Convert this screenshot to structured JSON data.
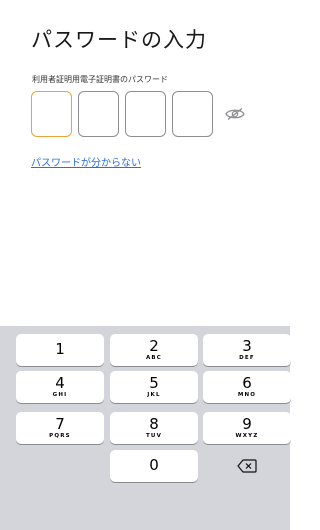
{
  "screen": {
    "title": "パスワードの入力",
    "field_label": "利用者証明用電子証明書のパスワード",
    "pin_length": 4,
    "active_pin_index": 0,
    "toggle_icon": "eye-icon",
    "help_link": "パスワードが分からない"
  },
  "keyboard": {
    "keys": [
      {
        "num": "1",
        "sub": ""
      },
      {
        "num": "2",
        "sub": "ABC"
      },
      {
        "num": "3",
        "sub": "DEF"
      },
      {
        "num": "4",
        "sub": "GHI"
      },
      {
        "num": "5",
        "sub": "JKL"
      },
      {
        "num": "6",
        "sub": "MNO"
      },
      {
        "num": "7",
        "sub": "PQRS"
      },
      {
        "num": "8",
        "sub": "TUV"
      },
      {
        "num": "9",
        "sub": "WXYZ"
      },
      {
        "num": "0",
        "sub": ""
      }
    ],
    "backspace_icon": "backspace-icon"
  },
  "colors": {
    "accent_active": "#e8a43a",
    "link": "#2d6fd6",
    "keyboard_bg": "#d3d5db"
  }
}
